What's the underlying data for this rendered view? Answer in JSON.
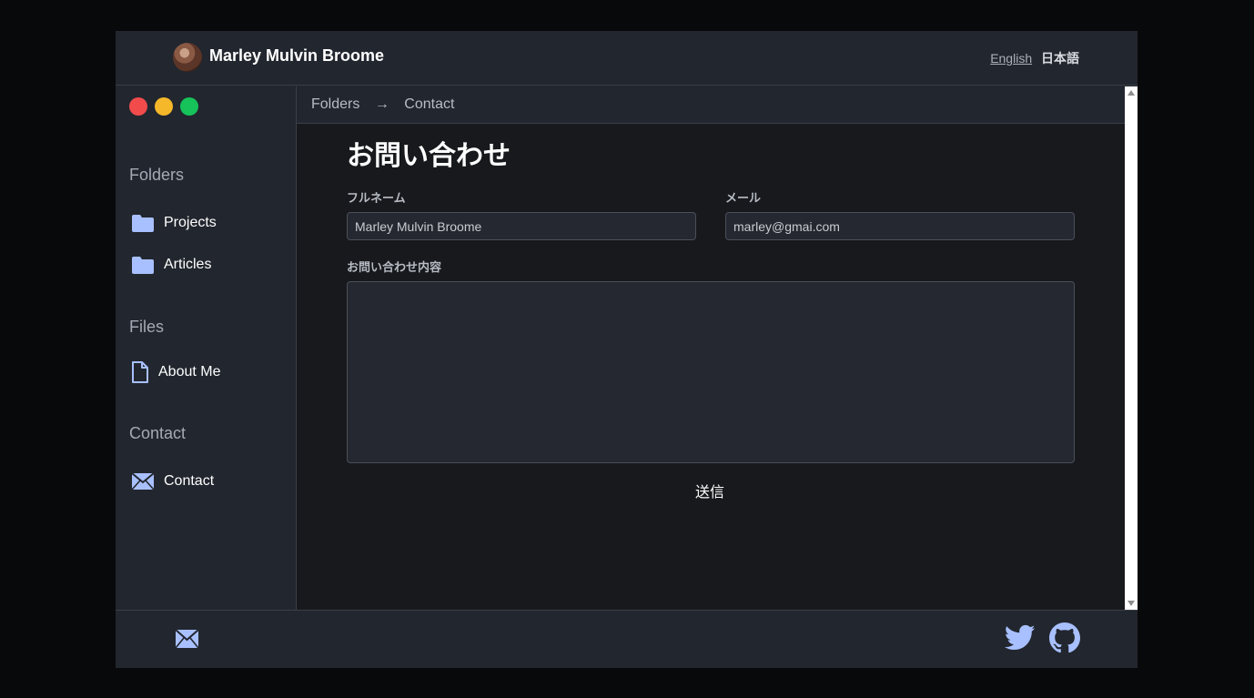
{
  "header": {
    "site_title": "Marley Mulvin Broome",
    "lang_en": "English",
    "lang_ja": "日本語"
  },
  "sidebar": {
    "sections": [
      {
        "title": "Folders",
        "items": [
          {
            "label": "Projects",
            "icon": "folder-icon"
          },
          {
            "label": "Articles",
            "icon": "folder-icon"
          }
        ]
      },
      {
        "title": "Files",
        "items": [
          {
            "label": "About Me",
            "icon": "file-icon"
          }
        ]
      },
      {
        "title": "Contact",
        "items": [
          {
            "label": "Contact",
            "icon": "mail-icon"
          }
        ]
      }
    ]
  },
  "breadcrumb": {
    "root": "Folders",
    "separator": "→",
    "current": "Contact"
  },
  "form": {
    "title": "お問い合わせ",
    "fullname_label": "フルネーム",
    "fullname_value": "Marley Mulvin Broome",
    "email_label": "メール",
    "email_value": "marley@gmai.com",
    "message_label": "お問い合わせ内容",
    "message_value": "",
    "submit_label": "送信"
  },
  "footer": {
    "icons": [
      "mail-icon",
      "twitter-icon",
      "github-icon"
    ]
  },
  "colors": {
    "accent_icon": "#a8c0ff",
    "dot_red": "#f14b4c",
    "dot_yellow": "#f5b82a",
    "dot_green": "#16c25a"
  }
}
